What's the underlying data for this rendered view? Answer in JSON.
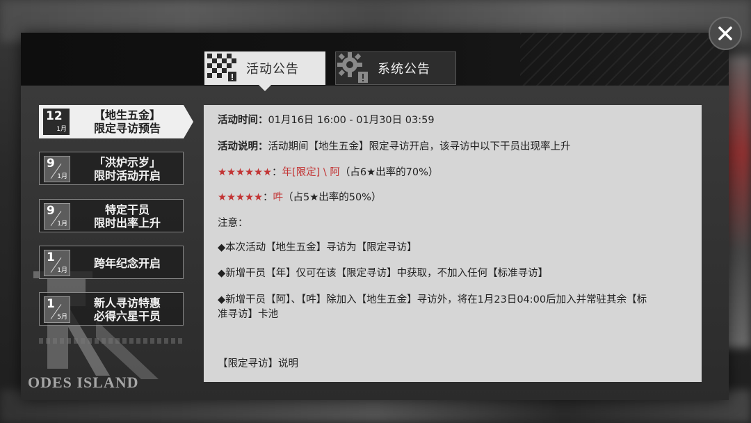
{
  "close_label": "✕",
  "tabs": [
    {
      "label": "活动公告",
      "icon": "checkered-flag-icon",
      "active": true
    },
    {
      "label": "系统公告",
      "icon": "gear-alert-icon",
      "active": false
    }
  ],
  "list": [
    {
      "day": "12",
      "month": "1月",
      "line1": "【地生五金】",
      "line2": "限定寻访预告",
      "active": true
    },
    {
      "day": "9",
      "month": "1月",
      "line1": "「洪炉示岁」",
      "line2": "限时活动开启",
      "active": false
    },
    {
      "day": "9",
      "month": "1月",
      "line1": "特定干员",
      "line2": "限时出率上升",
      "active": false
    },
    {
      "day": "1",
      "month": "1月",
      "line1": "跨年纪念开启",
      "line2": "",
      "active": false
    },
    {
      "day": "1",
      "month": "5月",
      "line1": "新人寻访特惠",
      "line2": "必得六星干员",
      "active": false
    }
  ],
  "watermark": "ODES ISLAND",
  "content": {
    "time_label": "活动时间：",
    "time_value": "01月16日 16:00 - 01月30日 03:59",
    "desc_label": "活动说明：",
    "desc_value": "活动期间【地生五金】限定寻访开启，该寻访中以下干员出现率上升",
    "six_star_stars": "★★★★★★",
    "six_star_colon": "：",
    "six_star_names": "年[限定] \\ 阿",
    "six_star_rate": "（占6★出率的70%）",
    "five_star_stars": "★★★★★",
    "five_star_colon": "：",
    "five_star_names": "吽",
    "five_star_rate": "（占5★出率的50%）",
    "note_label": "注意：",
    "note1": "◆本次活动【地生五金】寻访为【限定寻访】",
    "note2": "◆新增干员【年】仅可在该【限定寻访】中获取，不加入任何【标准寻访】",
    "note3_line1": "◆新增干员【阿】、【吽】除加入【地生五金】寻访外，将在1月23日04:00后加入并常驻其余【标",
    "note3_line2": "准寻访】卡池",
    "footer_link": "【限定寻访】说明"
  }
}
